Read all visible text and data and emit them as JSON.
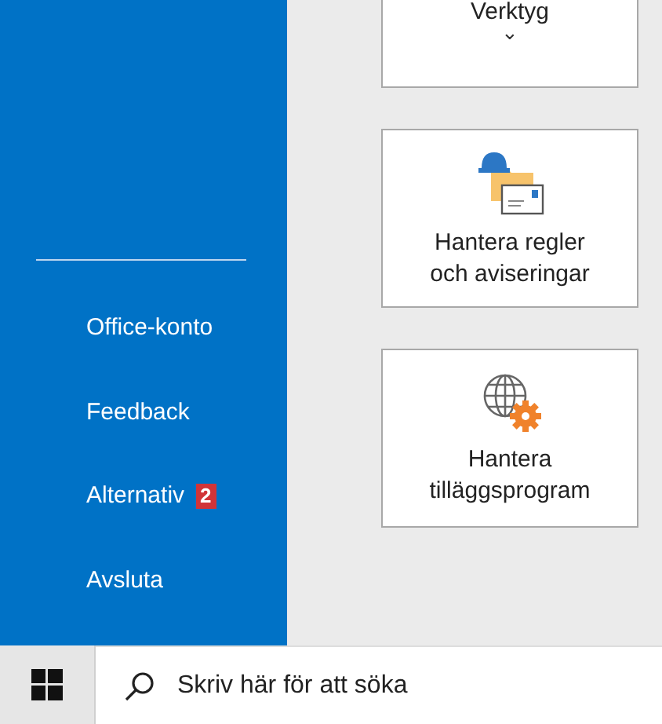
{
  "sidebar": {
    "items": [
      {
        "label": "Office-konto"
      },
      {
        "label": "Feedback"
      },
      {
        "label": "Alternativ",
        "badge": "2"
      },
      {
        "label": "Avsluta"
      }
    ]
  },
  "tiles": [
    {
      "kind": "dropdown",
      "label": "Verktyg",
      "caret": "⌄"
    },
    {
      "kind": "rules",
      "label": "Hantera regler och aviseringar"
    },
    {
      "kind": "addins",
      "label": "Hantera tilläggsprogram"
    }
  ],
  "taskbar": {
    "search": {
      "placeholder": "Skriv här för att söka"
    }
  }
}
